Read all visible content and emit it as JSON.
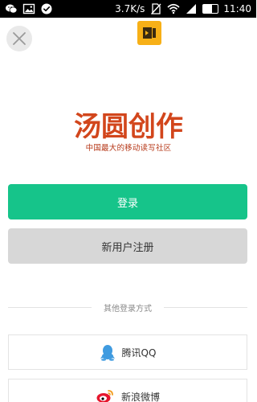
{
  "status_bar": {
    "network_speed": "3.7K/s",
    "battery_level": "59",
    "time": "11:40",
    "icons": [
      "wechat-icon",
      "image-icon",
      "check-circle-icon",
      "no-sim-icon",
      "wifi-icon",
      "signal-icon",
      "battery-icon"
    ]
  },
  "header": {
    "close_icon": "close-icon",
    "app_icon": "app-badge-icon"
  },
  "logo": {
    "title": "汤圆创作",
    "subtitle": "中国最大的移动读写社区"
  },
  "actions": {
    "login_label": "登录",
    "register_label": "新用户注册"
  },
  "other_login": {
    "label": "其他登录方式",
    "qq_label": "腾讯QQ",
    "weibo_label": "新浪微博"
  },
  "colors": {
    "primary_green": "#16c48a",
    "logo_orange": "#d2461c",
    "badge_yellow": "#f7b017",
    "qq_blue": "#3f9be0",
    "weibo_red": "#e6162d"
  }
}
